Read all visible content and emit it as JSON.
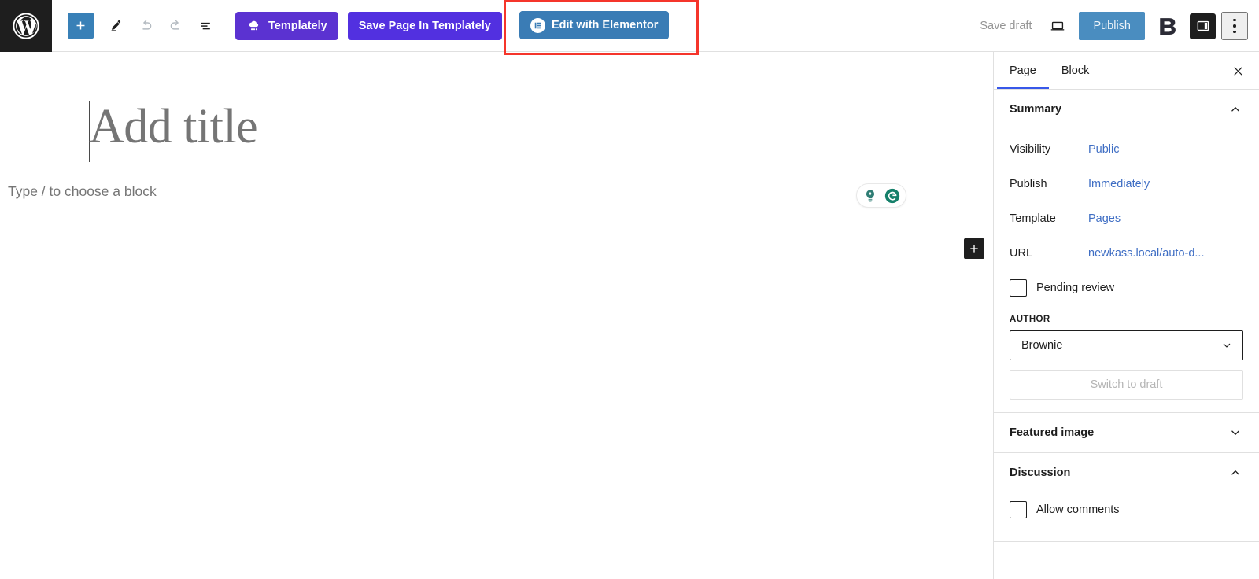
{
  "topbar": {
    "logo_icon": "wordpress-logo-icon",
    "add_block_icon": "plus-icon",
    "add_block_label": "+",
    "tools_icon": "pencil-tools-icon",
    "undo_icon": "undo-arrow-icon",
    "redo_icon": "redo-arrow-icon",
    "list_view_icon": "document-overview-list-icon",
    "templately_label": "Templately",
    "templately_icon": "templately-cloud-icon",
    "save_page_templately_label": "Save Page In Templately",
    "elementor_label": "Edit with Elementor",
    "elementor_icon": "elementor-circle-icon",
    "save_draft_label": "Save draft",
    "preview_icon": "laptop-preview-icon",
    "publish_label": "Publish",
    "eb_icon": "essential-blocks-icon",
    "settings_sidebar_icon": "settings-panel-icon",
    "options_icon": "three-dots-vertical-icon"
  },
  "highlight": {
    "color": "#f5352b",
    "target": "Edit with Elementor"
  },
  "canvas": {
    "title_placeholder": "Add title",
    "block_placeholder": "Type / to choose a block",
    "grammarly": {
      "bulb_icon": "lightbulb-idea-icon",
      "grammarly_icon": "grammarly-g-icon"
    },
    "inserter_icon": "plus-icon"
  },
  "sidebar": {
    "tabs": [
      {
        "label": "Page",
        "active": true
      },
      {
        "label": "Block",
        "active": false
      }
    ],
    "close_icon": "close-x-icon",
    "sections": [
      {
        "title": "Summary",
        "expanded": true,
        "chevron": "chevron-up-icon"
      },
      {
        "title": "Featured image",
        "expanded": false,
        "chevron": "chevron-down-icon"
      },
      {
        "title": "Discussion",
        "expanded": true,
        "chevron": "chevron-up-icon"
      }
    ],
    "summary": {
      "rows": [
        {
          "label": "Visibility",
          "value": "Public"
        },
        {
          "label": "Publish",
          "value": "Immediately"
        },
        {
          "label": "Template",
          "value": "Pages"
        },
        {
          "label": "URL",
          "value": "newkass.local/auto-d..."
        }
      ],
      "pending_review_label": "Pending review",
      "pending_review_checked": false,
      "author_group_label": "AUTHOR",
      "author_value": "Brownie",
      "author_chevron": "chevron-down-icon",
      "switch_to_draft_label": "Switch to draft"
    },
    "discussion": {
      "allow_comments_label": "Allow comments",
      "allow_comments_checked": false
    }
  },
  "colors": {
    "accent_blue": "#3858e9",
    "publish_blue": "#4a8dc0",
    "templately_purple": "#5b32d1",
    "link_blue": "#3f6ec4",
    "highlight_red": "#f5352b"
  }
}
